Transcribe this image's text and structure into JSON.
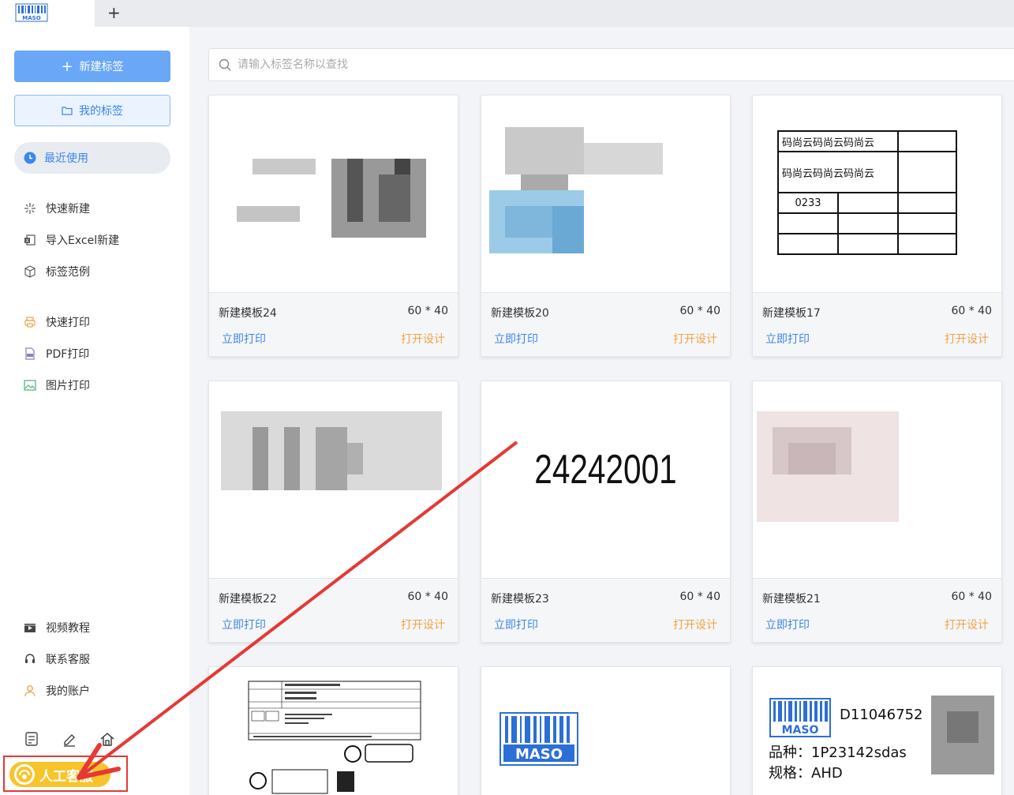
{
  "app": {
    "logo_text": "MASO",
    "new_tab_icon": "plus-icon"
  },
  "sidebar": {
    "new_label": "新建标签",
    "my_labels": "我的标签",
    "recent": "最近使用",
    "menu_top": [
      {
        "label": "快速新建",
        "icon": "sparkle-icon"
      },
      {
        "label": "导入Excel新建",
        "icon": "excel-icon"
      },
      {
        "label": "标签范例",
        "icon": "box-icon"
      }
    ],
    "menu_print": [
      {
        "label": "快速打印",
        "icon": "printer-icon"
      },
      {
        "label": "PDF打印",
        "icon": "pdf-icon"
      },
      {
        "label": "图片打印",
        "icon": "image-icon"
      }
    ],
    "menu_bottom": [
      {
        "label": "视频教程",
        "icon": "video-icon"
      },
      {
        "label": "联系客服",
        "icon": "headset-icon"
      },
      {
        "label": "我的账户",
        "icon": "user-icon"
      }
    ],
    "service_label": "人工客服"
  },
  "search": {
    "placeholder": "请输入标签名称以查找"
  },
  "cards": [
    {
      "name": "新建模板24",
      "size": "60 * 40",
      "print": "立即打印",
      "design": "打开设计"
    },
    {
      "name": "新建模板20",
      "size": "60 * 40",
      "print": "立即打印",
      "design": "打开设计"
    },
    {
      "name": "新建模板17",
      "size": "60 * 40",
      "print": "立即打印",
      "design": "打开设计"
    },
    {
      "name": "新建模板22",
      "size": "60 * 40",
      "print": "立即打印",
      "design": "打开设计"
    },
    {
      "name": "新建模板23",
      "size": "60 * 40",
      "print": "立即打印",
      "design": "打开设计"
    },
    {
      "name": "新建模板21",
      "size": "60 * 40",
      "print": "立即打印",
      "design": "打开设计"
    }
  ],
  "preview17": {
    "row1": "码尚云码尚云码尚云",
    "row2": "码尚云码尚云码尚云",
    "row3": "0233"
  },
  "preview23": {
    "number": "24242001"
  },
  "preview_bottom3": {
    "code": "D11046752",
    "line1": "品种：1P23142sdas",
    "line2": "规格：AHD"
  },
  "colors": {
    "accent": "#3d86ee",
    "orange": "#f0a34a",
    "service": "#f7c42b",
    "alert": "#e53935"
  }
}
